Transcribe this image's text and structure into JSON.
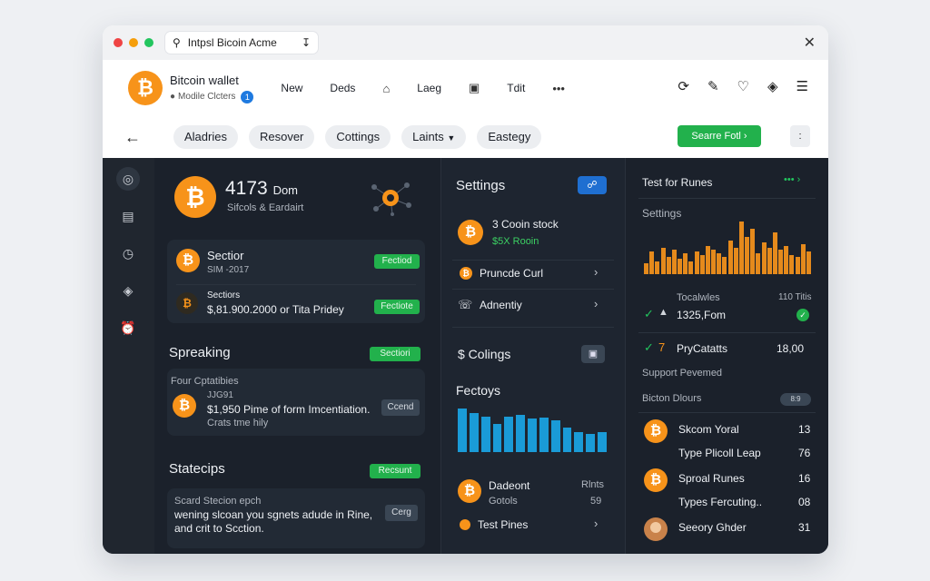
{
  "browser": {
    "url_text": "Intpsl Bicoin Acme",
    "dots": [
      "#ef4444",
      "#f59e0b",
      "#22c55e"
    ]
  },
  "app": {
    "brand_title": "Bitcoin wallet",
    "brand_sub": "Modile Clcters",
    "badge": "1",
    "nav": [
      "New",
      "Deds",
      "Laeg",
      "Tdit"
    ]
  },
  "filters": {
    "chips": [
      "Aladries",
      "Resover",
      "Cottings",
      "Laints",
      "Eastegy"
    ],
    "primary_button": "Searre Fotl",
    "square_button": ":"
  },
  "col1": {
    "hero_amount": "4173",
    "hero_unit": "Dom",
    "hero_sub": "Sifcols & Eardairt",
    "card1": {
      "row1_title": "Sectior",
      "row1_sub": "SIM -2017",
      "row1_tag": "Fectiod",
      "row2_title": "Sectiors",
      "row2_value": "$,81.900.2000 or Tita Pridey",
      "row2_tag": "Fectiote"
    },
    "section2": {
      "title": "Spreaking",
      "tag": "Sectiori",
      "label": "Four Cptatibies",
      "line1": "JJG91",
      "line2": "$1,950 Pime of form Imcentiation.",
      "line3": "Crats tme hily",
      "side_tag": "Ccend"
    },
    "section3": {
      "title": "Statecips",
      "tag": "Recsunt",
      "line1": "Scard Stecion epch",
      "line2": "wening slcoan you sgnets adude in Rine,",
      "line3": "and crit to Scction.",
      "side_tag": "Cerg"
    }
  },
  "col2": {
    "title": "Settings",
    "coin_title": "3 Cooin stock",
    "coin_sub": "$5X Rooin",
    "item1": "Pruncde Curl",
    "item2": "Adnentiy",
    "coll_title": "$ Colings",
    "fact_title": "Fectoys",
    "bars": [
      47,
      42,
      38,
      30,
      38,
      40,
      36,
      37,
      34,
      26,
      22,
      20,
      22
    ],
    "row_title": "Dadeont",
    "row_right": "Rlnts",
    "row_sub": "Gotols",
    "row_sub_right": "59",
    "last_item": "Test Pines"
  },
  "col3": {
    "title": "Test for Runes",
    "subtitle": "Settings",
    "bars": [
      12,
      24,
      14,
      28,
      18,
      26,
      16,
      22,
      14,
      24,
      20,
      30,
      26,
      22,
      18,
      36,
      28,
      56,
      40,
      48,
      22,
      34,
      28,
      44,
      26,
      30,
      20,
      18,
      32,
      24
    ],
    "stat_label": "Tocalwles",
    "stat_right": "110 Titis",
    "stat_value": "1325,Fom",
    "row2_num": "7",
    "row2_title": "PryCatatts",
    "row2_value": "18,00",
    "support": "Support Pevemed",
    "bicton": "Bicton Dlours",
    "bicton_badge": "8:9",
    "list": [
      {
        "title": "Skcom Yoral",
        "value": "13"
      },
      {
        "title": "Type Plicoll Leap",
        "value": "76"
      },
      {
        "title": "Sproal Runes",
        "value": "16"
      },
      {
        "title": "Types Fercuting..",
        "value": "08"
      },
      {
        "title": "Seeory Ghder",
        "value": "31"
      }
    ]
  },
  "colors": {
    "bitcoin_orange": "#f7931a",
    "accent_green": "#22b14c",
    "accent_blue": "#1f7ae0",
    "bar_blue": "#1a9bd7",
    "bar_orange": "#e58a1c"
  }
}
